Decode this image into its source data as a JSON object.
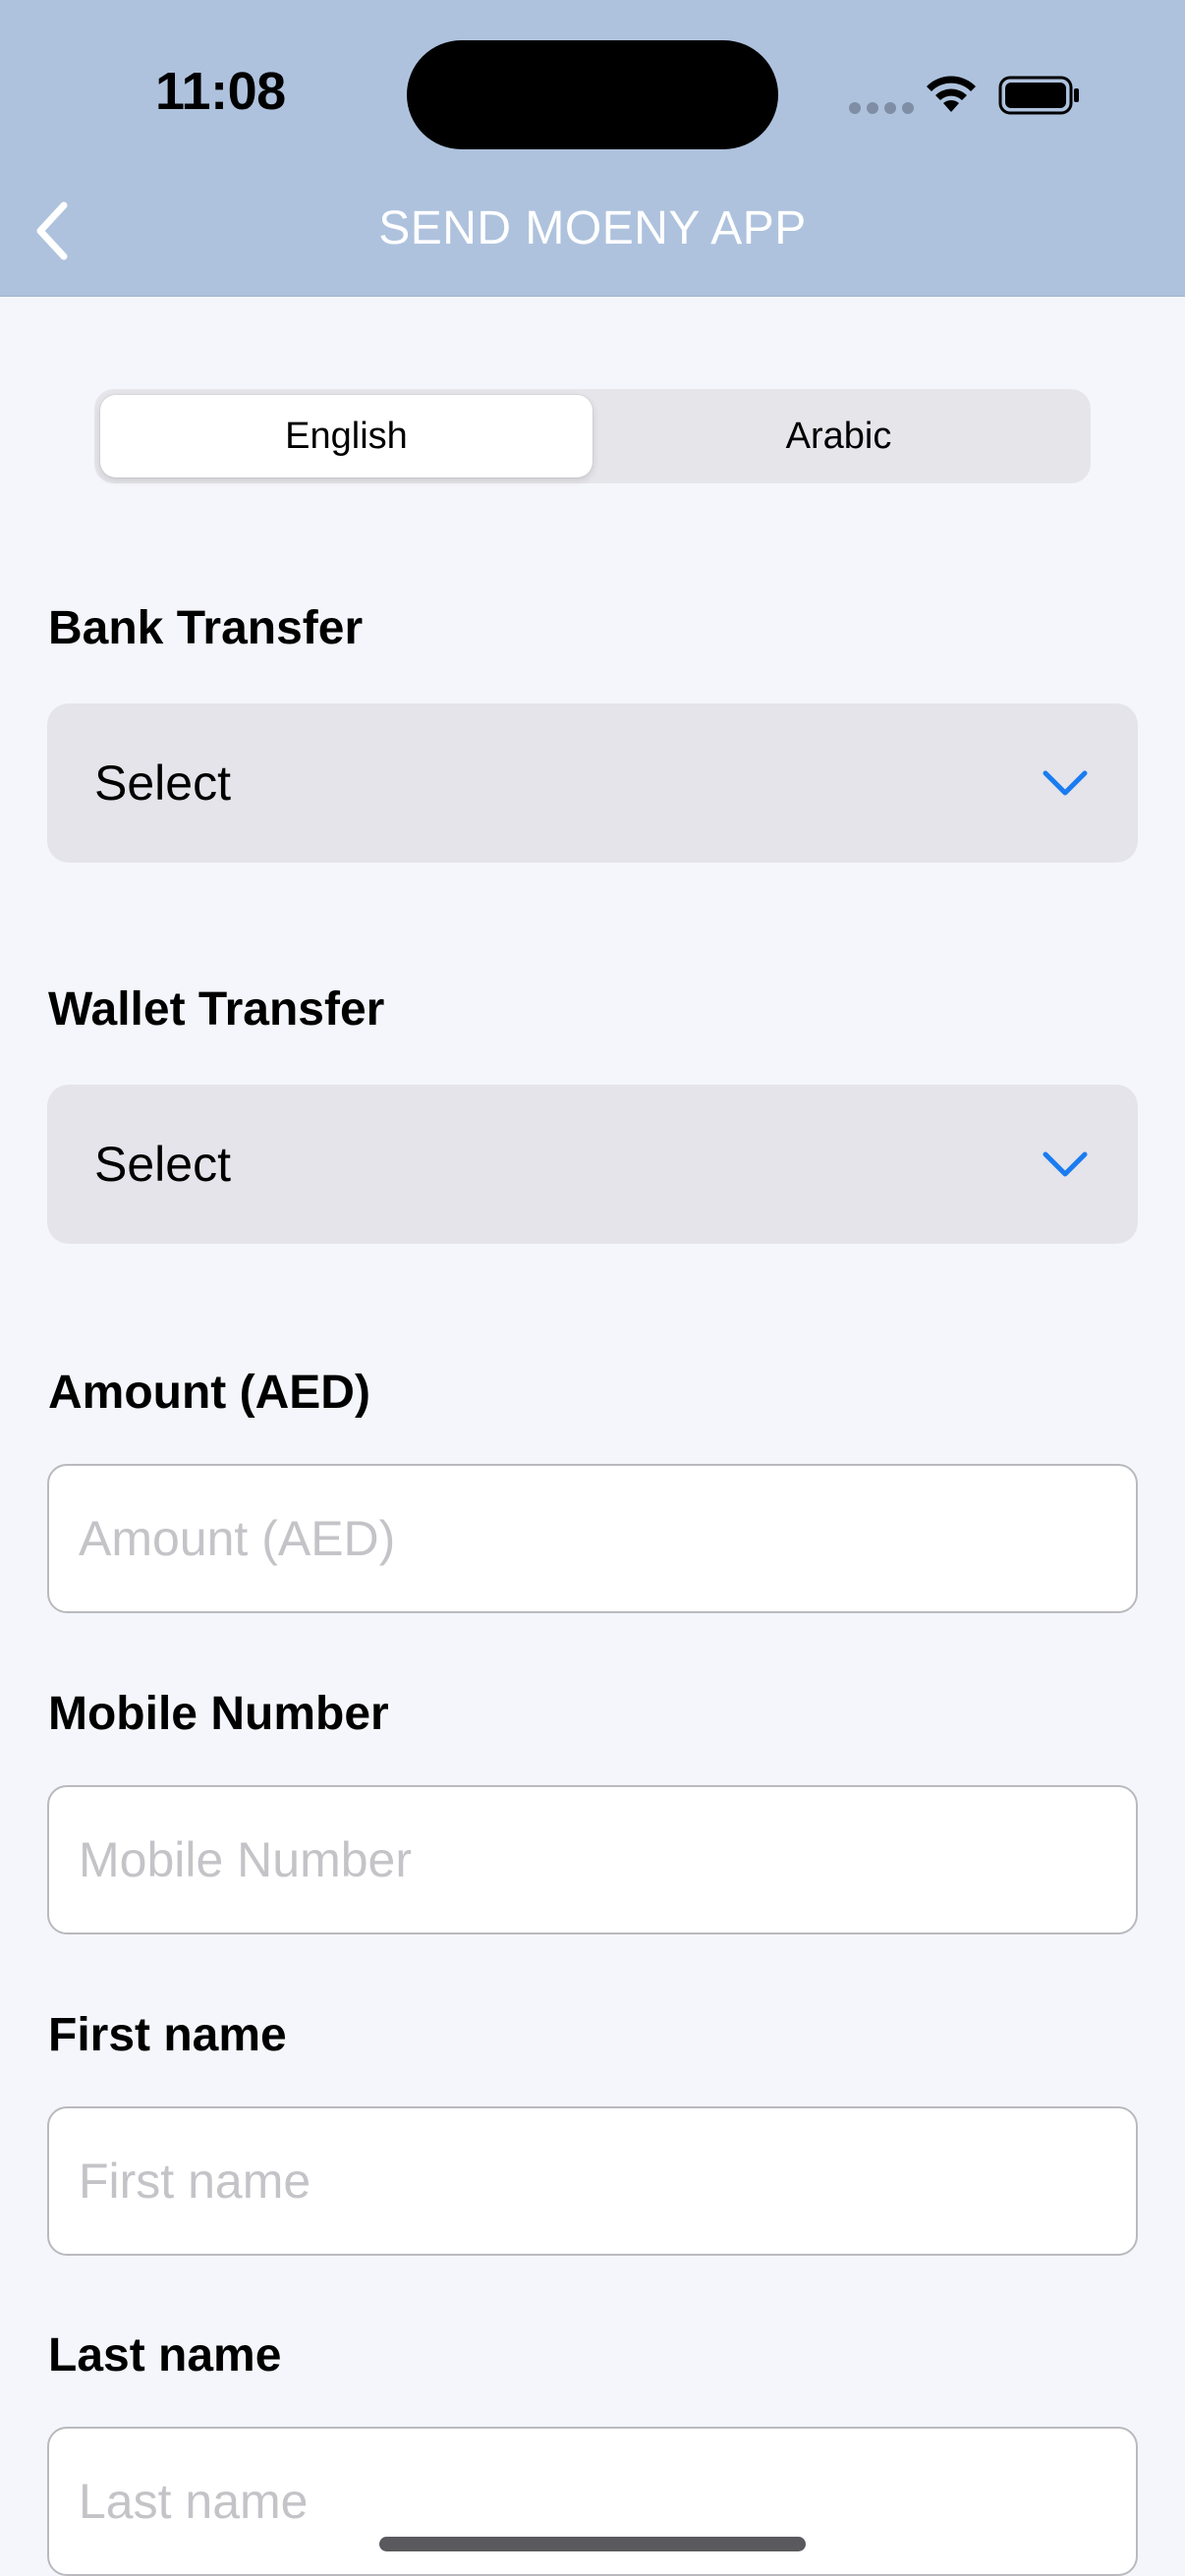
{
  "status_bar": {
    "time": "11:08",
    "icons": [
      "cellular-signal-icon",
      "wifi-icon",
      "battery-icon"
    ]
  },
  "nav": {
    "back_icon": "chevron-left-icon",
    "title": "SEND MOENY APP"
  },
  "language_toggle": {
    "options": [
      "English",
      "Arabic"
    ],
    "selected": "English"
  },
  "form": {
    "bank_transfer": {
      "label": "Bank Transfer",
      "value": "Select",
      "icon": "chevron-down-icon"
    },
    "wallet_transfer": {
      "label": "Wallet Transfer",
      "value": "Select",
      "icon": "chevron-down-icon"
    },
    "amount": {
      "label": "Amount (AED)",
      "placeholder": "Amount (AED)",
      "value": ""
    },
    "mobile": {
      "label": "Mobile Number",
      "placeholder": "Mobile Number",
      "value": ""
    },
    "first_name": {
      "label": "First name",
      "placeholder": "First name",
      "value": ""
    },
    "last_name": {
      "label": "Last name",
      "placeholder": "Last name",
      "value": ""
    }
  },
  "colors": {
    "header_bg": "#aec2dd",
    "page_bg": "#f5f6fb",
    "accent_chevron": "#1a7cf0",
    "dropdown_bg": "#e4e4ea"
  }
}
